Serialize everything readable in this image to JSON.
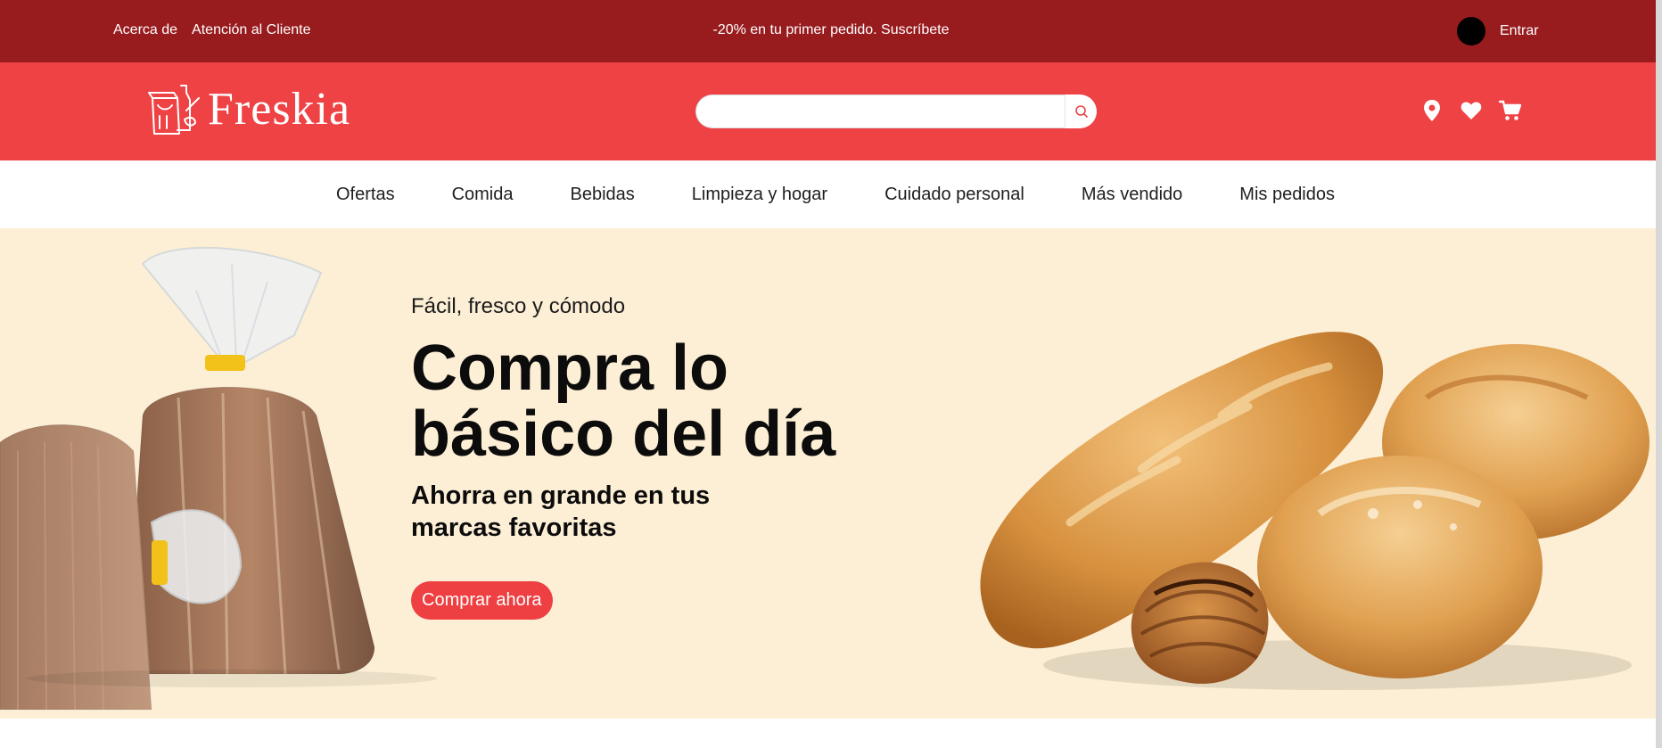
{
  "topbar": {
    "links": [
      "Acerca de",
      "Atención al Cliente"
    ],
    "promo": "-20% en tu primer pedido. Suscríbete",
    "login": "Entrar"
  },
  "header": {
    "brand": "Freskia",
    "search": {
      "placeholder": "",
      "value": ""
    },
    "icons": [
      "location-pin-icon",
      "heart-icon",
      "cart-icon"
    ]
  },
  "nav": {
    "items": [
      "Ofertas",
      "Comida",
      "Bebidas",
      "Limpieza y hogar",
      "Cuidado personal",
      "Más vendido",
      "Mis pedidos"
    ]
  },
  "hero": {
    "tagline": "Fácil, fresco y cómodo",
    "headline": "Compra lo básico del día",
    "subhead": "Ahorra en grande en tus marcas favoritas",
    "cta": "Comprar ahora"
  },
  "colors": {
    "topbar": "#981b1e",
    "header": "#ee4245",
    "hero_bg": "#fdefd5",
    "cta": "#ee3f42"
  }
}
